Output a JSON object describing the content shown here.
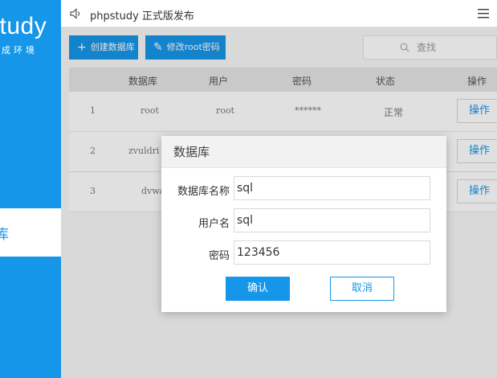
{
  "sidebar": {
    "logo_text": "study",
    "logo_sub": "成环境",
    "active_item": "库"
  },
  "topbar": {
    "title": "phpstudy 正式版发布"
  },
  "toolbar": {
    "create_label": "创建数据库",
    "modify_label": "修改root密码",
    "search_placeholder": "查找"
  },
  "table": {
    "columns": [
      "数据库",
      "用户",
      "密码",
      "状态",
      "操作"
    ],
    "rows": [
      {
        "index": "1",
        "db": "root",
        "user": "root",
        "password": "******",
        "status": "正常",
        "action": "操作"
      },
      {
        "index": "2",
        "db": "zvuldri",
        "user": "",
        "password": "",
        "status": "",
        "action": "操作"
      },
      {
        "index": "3",
        "db": "dvwa",
        "user": "",
        "password": "",
        "status": "",
        "action": "操作"
      }
    ]
  },
  "dialog": {
    "title": "数据库",
    "fields": [
      {
        "label": "数据库名称",
        "value": "sql"
      },
      {
        "label": "用户名",
        "value": "sql"
      },
      {
        "label": "密码",
        "value": "123456"
      }
    ],
    "ok_label": "确认",
    "cancel_label": "取消"
  },
  "colors": {
    "accent": "#1696e8"
  }
}
